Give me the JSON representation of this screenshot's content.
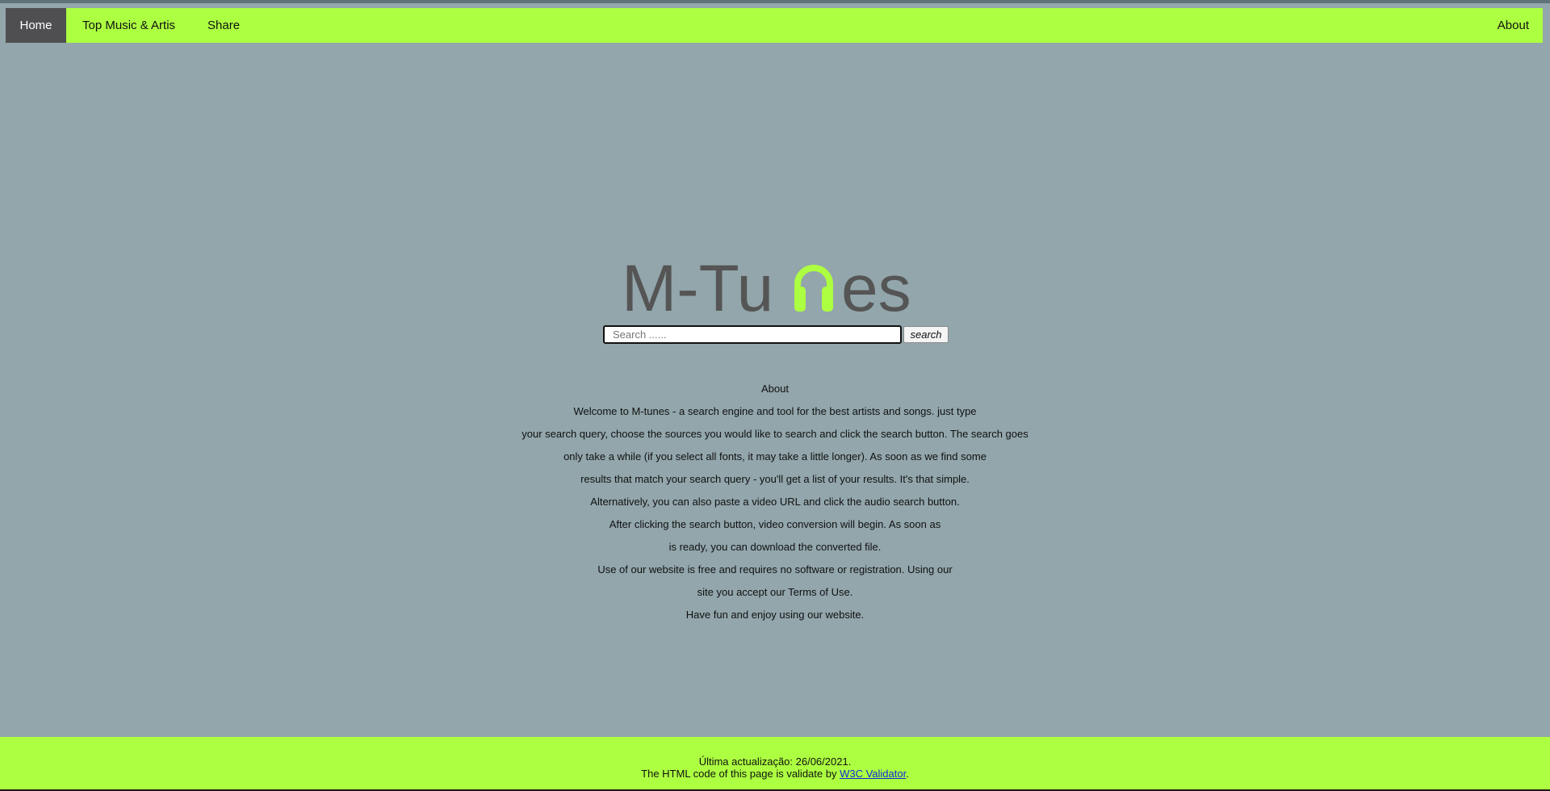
{
  "nav": {
    "home": "Home",
    "top_music": "Top Music & Artis",
    "share": "Share",
    "about": "About"
  },
  "logo": {
    "left_text": "M-Tu",
    "right_text": "es",
    "icon": "headphones-icon",
    "text_color": "#555555",
    "accent_color": "#adff41"
  },
  "search": {
    "placeholder": "Search ......",
    "value": "",
    "button_label": "search"
  },
  "about": {
    "heading": "About",
    "lines": [
      "Welcome to M-tunes - a search engine and tool for the best artists and songs. just type",
      "your search query, choose the sources you would like to search and click the search button. The search goes",
      "only take a while (if you select all fonts, it may take a little longer). As soon as we find some",
      "results that match your search query - you'll get a list of your results. It's that simple.",
      "Alternatively, you can also paste a video URL and click the audio search button.",
      "After clicking the search button, video conversion will begin. As soon as",
      "is ready, you can download the converted file.",
      "Use of our website is free and requires no software or registration. Using our",
      "site you accept our Terms of Use.",
      "Have fun and enjoy using our website."
    ]
  },
  "footer": {
    "last_update": "Última actualização: 26/06/2021.",
    "validate_prefix": "The HTML code of this page is validate by ",
    "validator_link": "W3C Validator",
    "validate_suffix": "."
  },
  "colors": {
    "nav_background": "#adff41",
    "active_tab": "#4f4f51",
    "page_background": "#92a6ab"
  }
}
